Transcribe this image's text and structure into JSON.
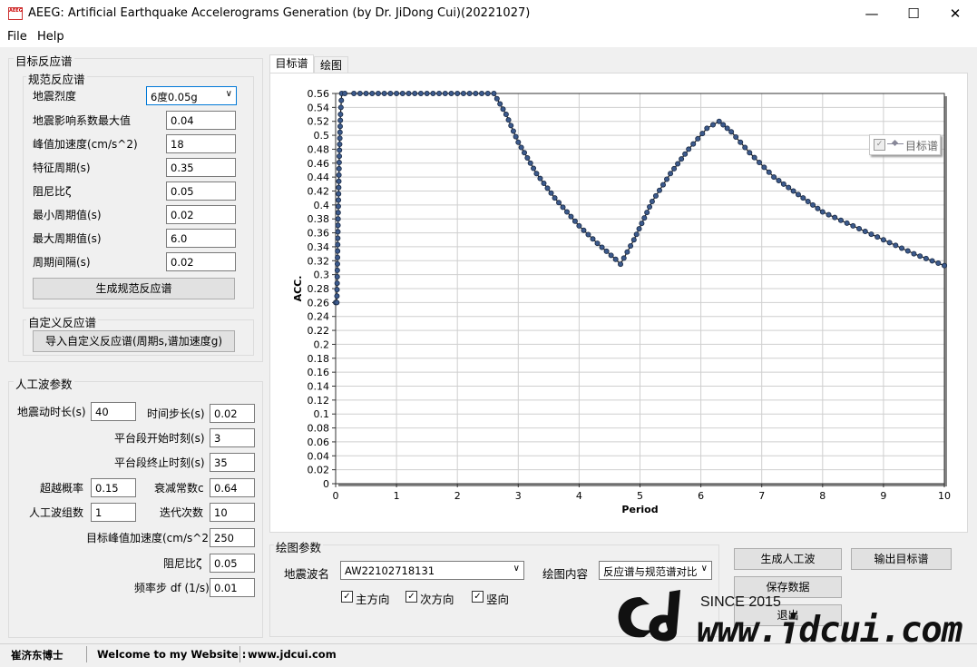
{
  "window": {
    "title": "AEEG: Artificial Earthquake Accelerograms Generation (by Dr. JiDong Cui)(20221027)",
    "icon_text": "AEEG",
    "min_glyph": "—",
    "max_glyph": "☐",
    "close_glyph": "✕"
  },
  "menu": {
    "file": "File",
    "help": "Help"
  },
  "target_spectrum": {
    "group_title": "目标反应谱",
    "code_group_title": "规范反应谱",
    "fields": [
      {
        "label": "地震烈度",
        "value": "6度0.05g"
      },
      {
        "label": "地震影响系数最大值",
        "value": "0.04"
      },
      {
        "label": "峰值加速度(cm/s^2)",
        "value": "18"
      },
      {
        "label": "特征周期(s)",
        "value": "0.35"
      },
      {
        "label": "阻尼比ζ",
        "value": "0.05"
      },
      {
        "label": "最小周期值(s)",
        "value": "0.02"
      },
      {
        "label": "最大周期值(s)",
        "value": "6.0"
      },
      {
        "label": "周期间隔(s)",
        "value": "0.02"
      }
    ],
    "generate_button": "生成规范反应谱",
    "custom_group_title": "自定义反应谱",
    "import_button": "导入自定义反应谱(周期s,谱加速度g)"
  },
  "wave_params": {
    "group_title": "人工波参数",
    "duration_label": "地震动时长(s)",
    "duration": "40",
    "timestep_label": "时间步长(s)",
    "timestep": "0.02",
    "plat_start_label": "平台段开始时刻(s)",
    "plat_start": "3",
    "plat_end_label": "平台段终止时刻(s)",
    "plat_end": "35",
    "exceed_label": "超越概率",
    "exceed": "0.15",
    "decay_label": "衰减常数c",
    "decay": "0.64",
    "count_label": "人工波组数",
    "count": "1",
    "iter_label": "迭代次数",
    "iter": "10",
    "pga_label": "目标峰值加速度(cm/s^2)",
    "pga": "250",
    "damping_label": "阻尼比ζ",
    "damping": "0.05",
    "df_label": "频率步 df (1/s)",
    "df": "0.01"
  },
  "tabs": {
    "target": "目标谱",
    "plot": "绘图"
  },
  "legend": {
    "series": "目标谱"
  },
  "plot_params": {
    "group_title": "绘图参数",
    "wave_label": "地震波名",
    "wave_value": "AW22102718131",
    "content_label": "绘图内容",
    "content_value": "反应谱与规范谱对比",
    "main_dir": "主方向",
    "sub_dir": "次方向",
    "vertical": "竖向"
  },
  "actions": {
    "generate_wave": "生成人工波",
    "export_target": "输出目标谱",
    "save_data": "保存数据",
    "exit": "退出"
  },
  "watermark": {
    "since": "SINCE 2015",
    "url": "www.jdcui.com",
    "logo": "Cd"
  },
  "status": {
    "author": "崔济东博士",
    "welcome": "Welcome to my Website :",
    "site": "www.jdcui.com"
  },
  "chart_data": {
    "type": "line",
    "xlabel": "Period",
    "ylabel": "ACC.",
    "xlim": [
      0,
      10
    ],
    "ylim": [
      0,
      0.56
    ],
    "xticks": [
      0,
      1,
      2,
      3,
      4,
      5,
      6,
      7,
      8,
      9,
      10
    ],
    "yticks": [
      0,
      0.02,
      0.04,
      0.06,
      0.08,
      0.1,
      0.12,
      0.14,
      0.16,
      0.18,
      0.2,
      0.22,
      0.24,
      0.26,
      0.28,
      0.3,
      0.32,
      0.34,
      0.36,
      0.38,
      0.4,
      0.42,
      0.44,
      0.46,
      0.48,
      0.5,
      0.52,
      0.54,
      0.56
    ],
    "grid": true,
    "legend_position": "top-right",
    "series": [
      {
        "name": "目标谱",
        "color": "#3c5a8c",
        "x": [
          0,
          0.02,
          0.04,
          0.06,
          0.08,
          0.1,
          0.15,
          0.3,
          0.6,
          1.0,
          1.5,
          2.0,
          2.5,
          2.6,
          2.8,
          3.0,
          3.3,
          3.6,
          4.0,
          4.3,
          4.6,
          4.68,
          4.9,
          5.2,
          5.5,
          5.8,
          6.1,
          6.3,
          6.5,
          6.8,
          7.2,
          7.6,
          8.0,
          8.5,
          9.0,
          9.5,
          10.0
        ],
        "y": [
          0.26,
          0.26,
          0.38,
          0.47,
          0.53,
          0.56,
          0.56,
          0.56,
          0.56,
          0.56,
          0.56,
          0.56,
          0.56,
          0.56,
          0.53,
          0.49,
          0.445,
          0.41,
          0.37,
          0.345,
          0.322,
          0.315,
          0.35,
          0.405,
          0.445,
          0.48,
          0.51,
          0.52,
          0.505,
          0.475,
          0.44,
          0.415,
          0.39,
          0.37,
          0.35,
          0.33,
          0.313
        ]
      }
    ]
  }
}
